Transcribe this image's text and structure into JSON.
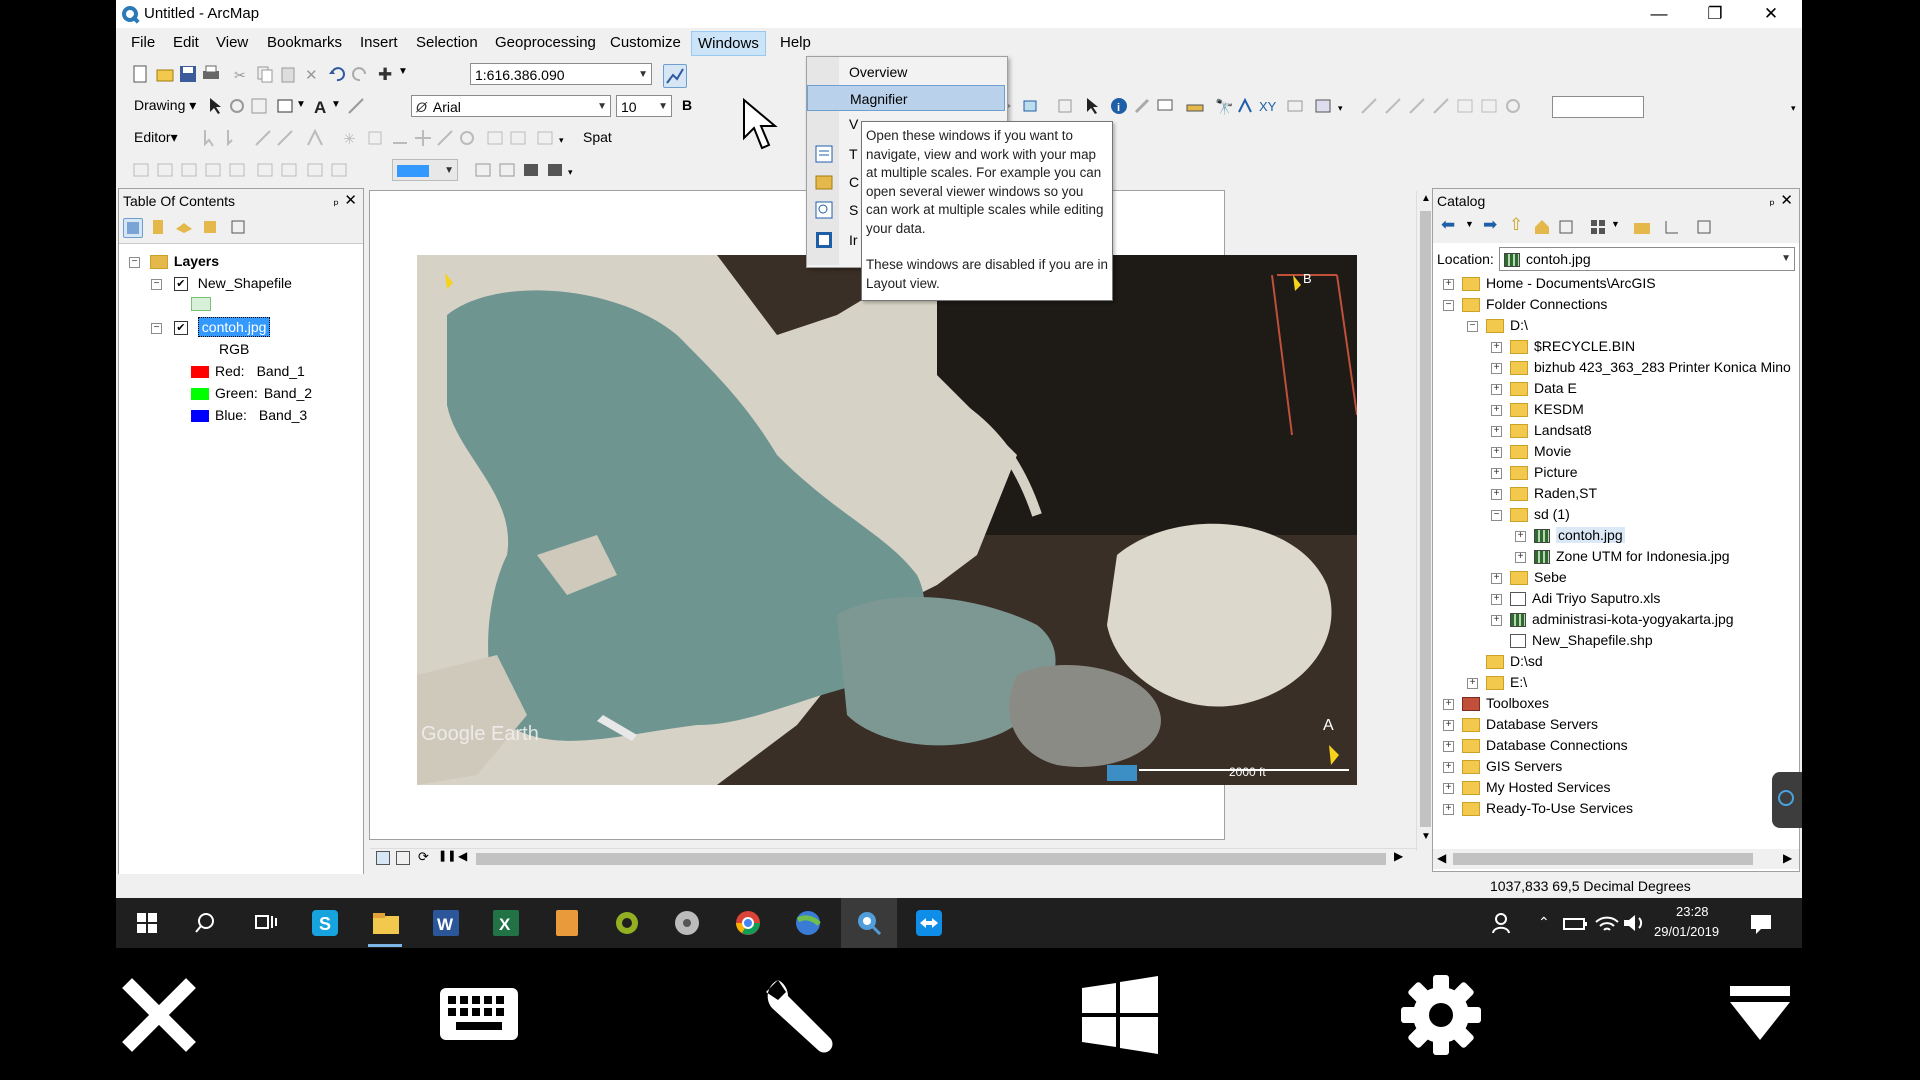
{
  "window": {
    "title": "Untitled - ArcMap",
    "minimize": "—",
    "restore": "❐",
    "close": "✕"
  },
  "menu": [
    "File",
    "Edit",
    "View",
    "Bookmarks",
    "Insert",
    "Selection",
    "Geoprocessing",
    "Customize",
    "Windows",
    "Help"
  ],
  "toolbar": {
    "scale": "1:616.386.090",
    "drawing_label": "Drawing",
    "font_name": "Arial",
    "font_size": "10",
    "editor_label": "Editor",
    "spatial_label": "Spat"
  },
  "windows_menu": {
    "items": [
      "Overview",
      "Magnifier",
      "V",
      "T",
      "C",
      "S",
      "Ir"
    ]
  },
  "tooltip": {
    "text1": "Open these windows if you want to navigate, view and work with your map at multiple scales. For example you can open several viewer windows so you can work at multiple scales while editing your data.",
    "text2": "These windows are disabled if you are in Layout view."
  },
  "toc": {
    "title": "Table Of Contents",
    "pin": "ₚ",
    "close": "✕",
    "layers_label": "Layers",
    "layer1": "New_Shapefile",
    "layer2": "contoh.jpg",
    "rgb": "RGB",
    "bands": [
      {
        "color": "Red:",
        "band": "Band_1",
        "hex": "#ff0000"
      },
      {
        "color": "Green:",
        "band": "Band_2",
        "hex": "#00ff00"
      },
      {
        "color": "Blue:",
        "band": "Band_3",
        "hex": "#0000ff"
      }
    ]
  },
  "map": {
    "watermark": "Google Earth",
    "scale_text": "2000 ft",
    "corner_label": "B",
    "north": "A"
  },
  "catalog": {
    "title": "Catalog",
    "location_label": "Location:",
    "location_value": "contoh.jpg",
    "tree": [
      {
        "label": "Home - Documents\\ArcGIS",
        "level": 0,
        "exp": "+",
        "icon": "folder"
      },
      {
        "label": "Folder Connections",
        "level": 0,
        "exp": "−",
        "icon": "folder"
      },
      {
        "label": "D:\\",
        "level": 1,
        "exp": "−",
        "icon": "folder"
      },
      {
        "label": "$RECYCLE.BIN",
        "level": 2,
        "exp": "+",
        "icon": "folder"
      },
      {
        "label": "bizhub 423_363_283 Printer Konica Mino",
        "level": 2,
        "exp": "+",
        "icon": "folder"
      },
      {
        "label": "Data E",
        "level": 2,
        "exp": "+",
        "icon": "folder"
      },
      {
        "label": "KESDM",
        "level": 2,
        "exp": "+",
        "icon": "folder"
      },
      {
        "label": "Landsat8",
        "level": 2,
        "exp": "+",
        "icon": "folder"
      },
      {
        "label": "Movie",
        "level": 2,
        "exp": "+",
        "icon": "folder"
      },
      {
        "label": "Picture",
        "level": 2,
        "exp": "+",
        "icon": "folder"
      },
      {
        "label": "Raden,ST",
        "level": 2,
        "exp": "+",
        "icon": "folder"
      },
      {
        "label": "sd (1)",
        "level": 2,
        "exp": "−",
        "icon": "folder"
      },
      {
        "label": "contoh.jpg",
        "level": 3,
        "exp": "+",
        "icon": "raster",
        "selected": true
      },
      {
        "label": "Zone UTM for Indonesia.jpg",
        "level": 3,
        "exp": "+",
        "icon": "raster"
      },
      {
        "label": "Sebe",
        "level": 2,
        "exp": "+",
        "icon": "folder"
      },
      {
        "label": "Adi Triyo Saputro.xls",
        "level": 2,
        "exp": "+",
        "icon": "table"
      },
      {
        "label": "administrasi-kota-yogyakarta.jpg",
        "level": 2,
        "exp": "+",
        "icon": "raster"
      },
      {
        "label": "New_Shapefile.shp",
        "level": 2,
        "exp": "",
        "icon": "shape"
      },
      {
        "label": "D:\\sd",
        "level": 1,
        "exp": "",
        "icon": "folder"
      },
      {
        "label": "E:\\",
        "level": 1,
        "exp": "+",
        "icon": "folder"
      },
      {
        "label": "Toolboxes",
        "level": 0,
        "exp": "+",
        "icon": "toolbox"
      },
      {
        "label": "Database Servers",
        "level": 0,
        "exp": "+",
        "icon": "folder"
      },
      {
        "label": "Database Connections",
        "level": 0,
        "exp": "+",
        "icon": "folder"
      },
      {
        "label": "GIS Servers",
        "level": 0,
        "exp": "+",
        "icon": "folder"
      },
      {
        "label": "My Hosted Services",
        "level": 0,
        "exp": "+",
        "icon": "folder"
      },
      {
        "label": "Ready-To-Use Services",
        "level": 0,
        "exp": "+",
        "icon": "folder"
      }
    ]
  },
  "status": {
    "coords": "1037,833  69,5 Decimal Degrees"
  },
  "taskbar": {
    "time": "23:28",
    "date": "29/01/2019"
  },
  "colors": {
    "menu_highlight": "#cce4f7",
    "selection": "#3399ff",
    "taskbar": "#1f1f1f"
  }
}
